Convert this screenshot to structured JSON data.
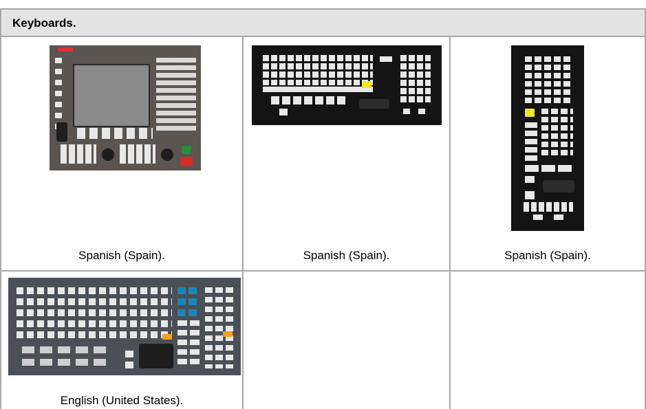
{
  "table": {
    "title": "Keyboards.",
    "rows": [
      [
        {
          "caption": "Spanish (Spain).",
          "image": "keyboard-8055-panel"
        },
        {
          "caption": "Spanish (Spain).",
          "image": "keyboard-horizontal"
        },
        {
          "caption": "Spanish (Spain).",
          "image": "keyboard-vertical"
        }
      ],
      [
        {
          "caption": "English (United States).",
          "image": "keyboard-qwerty-full"
        },
        {
          "caption": "",
          "image": ""
        },
        {
          "caption": "",
          "image": ""
        }
      ]
    ]
  }
}
